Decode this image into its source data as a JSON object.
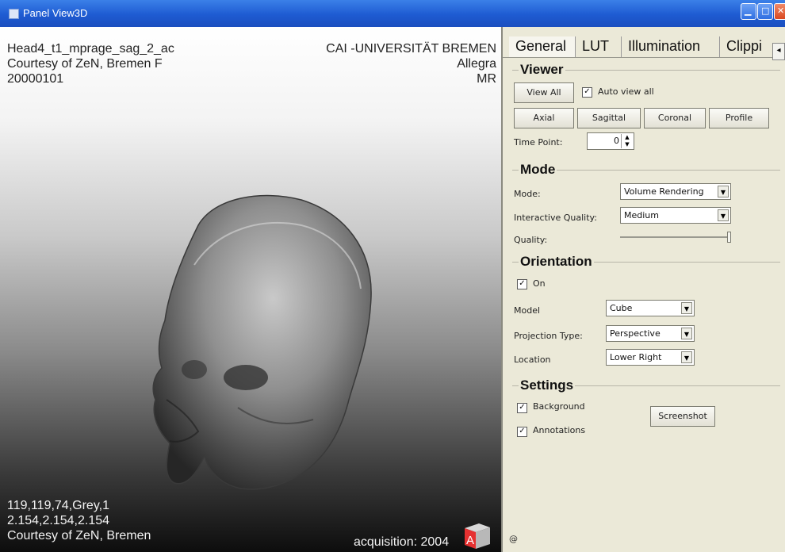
{
  "window": {
    "title": "Panel View3D"
  },
  "viewer": {
    "top_left": {
      "line1": "Head4_t1_mprage_sag_2_ac",
      "line2": "Courtesy of ZeN, Bremen F",
      "line3": "20000101"
    },
    "top_right": {
      "line1": "CAI -UNIVERSITÄT BREMEN",
      "line2": "Allegra",
      "line3": "MR"
    },
    "bottom_left": {
      "line1": "119,119,74,Grey,1",
      "line2": "2.154,2.154,2.154",
      "line3": "Courtesy of ZeN, Bremen"
    },
    "bottom_right": {
      "line1": "acquisition: 2004"
    },
    "orientation_cube_letter": "A"
  },
  "tabs": [
    {
      "label": "General"
    },
    {
      "label": "LUT"
    },
    {
      "label": "Illumination"
    },
    {
      "label": "Clippi"
    }
  ],
  "viewer_group": {
    "title": "Viewer",
    "view_all": "View All",
    "auto_view_all": "Auto view all",
    "axial": "Axial",
    "sagittal": "Sagittal",
    "coronal": "Coronal",
    "profile": "Profile",
    "time_point_label": "Time Point:",
    "time_point_value": "0"
  },
  "mode_group": {
    "title": "Mode",
    "mode_label": "Mode:",
    "mode_value": "Volume Rendering",
    "iq_label": "Interactive Quality:",
    "iq_value": "Medium",
    "quality_label": "Quality:"
  },
  "orientation_group": {
    "title": "Orientation",
    "on_label": "On",
    "model_label": "Model",
    "model_value": "Cube",
    "projection_label": "Projection Type:",
    "projection_value": "Perspective",
    "location_label": "Location",
    "location_value": "Lower Right"
  },
  "settings_group": {
    "title": "Settings",
    "background_label": "Background",
    "annotations_label": "Annotations",
    "screenshot": "Screenshot"
  },
  "status": {
    "text": "@"
  }
}
